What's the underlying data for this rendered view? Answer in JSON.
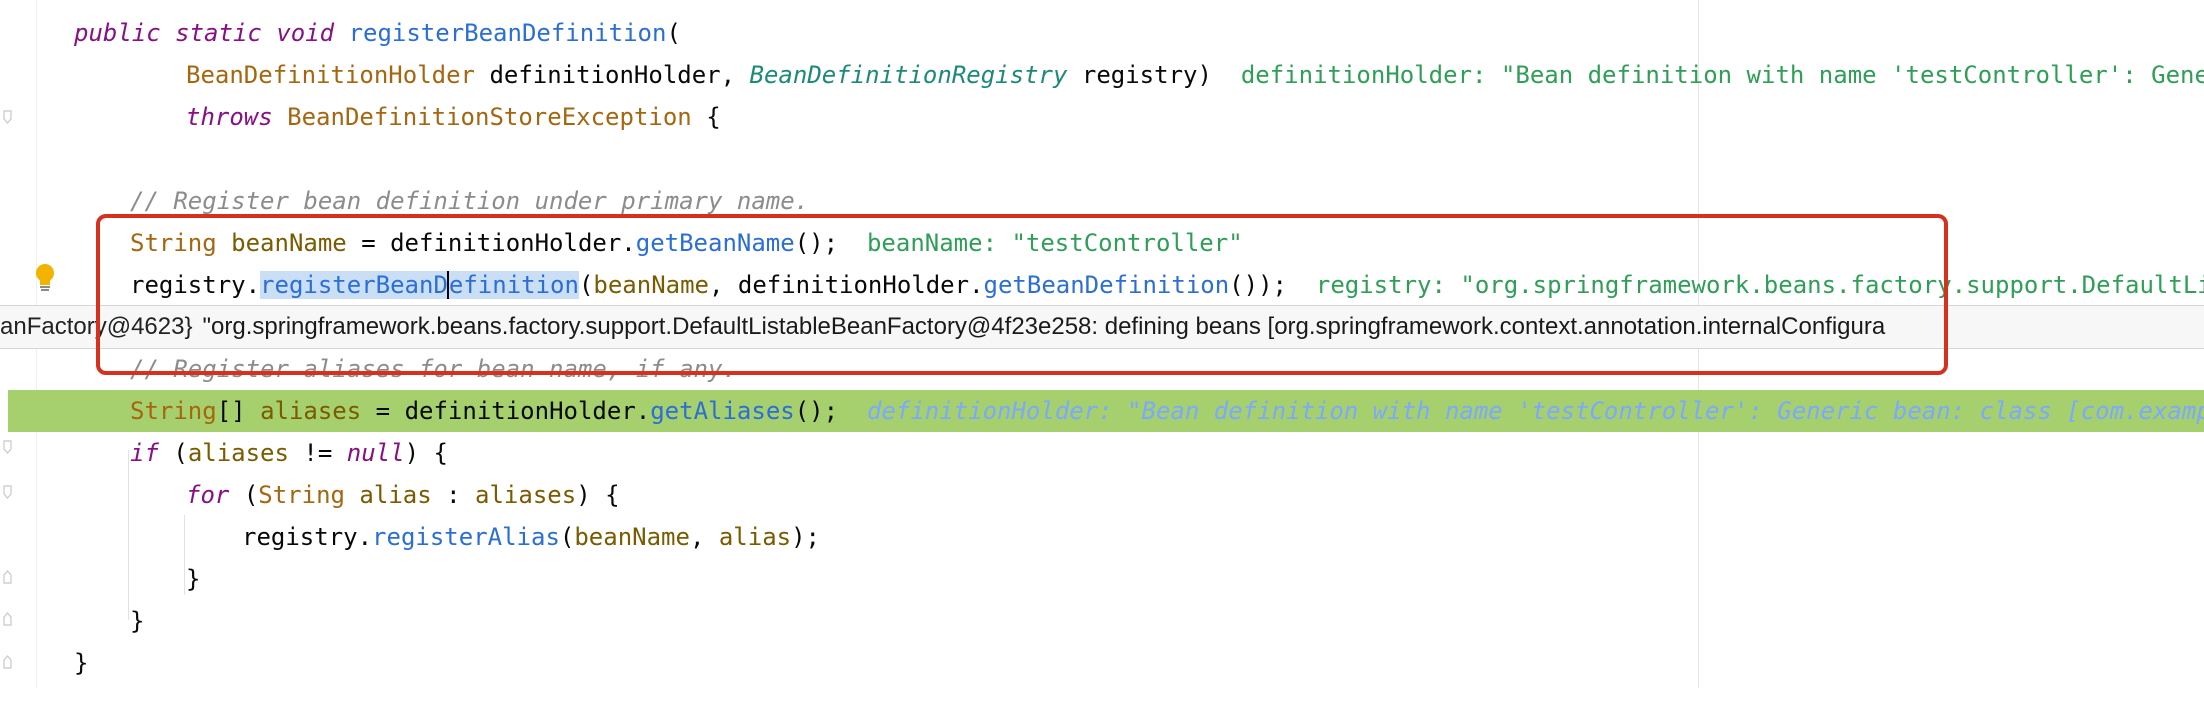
{
  "editor": {
    "line_signature": {
      "kw_public": "public",
      "kw_static": "static",
      "kw_void": "void",
      "method_name": "registerBeanDefinition",
      "paren_open": "("
    },
    "line_params": {
      "type1": "BeanDefinitionHolder",
      "param1": "definitionHolder,",
      "type2": "BeanDefinitionRegistry",
      "param2": "registry)",
      "inline_value": "definitionHolder: \"Bean definition with name 'testController': Generic"
    },
    "line_throws": {
      "kw_throws": "throws",
      "exception": "BeanDefinitionStoreException",
      "brace": "{"
    },
    "line_comment1": "// Register bean definition under primary name.",
    "line_beanname": {
      "type": "String",
      "var": "beanName",
      "eq": "=",
      "obj": "definitionHolder.",
      "call": "getBeanName",
      "tail": "();",
      "inline_value": "beanName: \"testController\""
    },
    "line_register": {
      "obj": "registry.",
      "call_selected_a": "registerBeanD",
      "call_selected_b": "efinition",
      "open": "(",
      "arg1": "beanName",
      "sep": ", definitionHolder.",
      "call2": "getBeanDefinition",
      "tail": "());",
      "inline_value": "registry: \"org.springframework.beans.factory.support.DefaultListab"
    },
    "line_comment2": "// Register aliases for bean name, if any.",
    "line_aliases": {
      "type": "String",
      "brackets": "[]",
      "var": "aliases",
      "eq": "=",
      "obj": "definitionHolder.",
      "call": "getAliases",
      "tail": "();",
      "inline_value": "definitionHolder: \"Bean definition with name 'testController': Generic bean: class [com.example.d"
    },
    "line_if": {
      "kw_if": "if",
      "open": "(",
      "var": "aliases",
      "op": "!=",
      "kw_null": "null",
      "close": ") {"
    },
    "line_for": {
      "kw_for": "for",
      "open": "(",
      "type": "String",
      "var": "alias",
      "colon": ":",
      "coll": "aliases",
      "close": ") {"
    },
    "line_alias_call": {
      "obj": "registry.",
      "call": "registerAlias",
      "open": "(",
      "arg1": "beanName",
      "sep": ", ",
      "arg2": "alias",
      "close": ");"
    },
    "brace_close_inner": "}",
    "brace_close_if": "}",
    "brace_close_method": "}"
  },
  "tooltip": {
    "type_label": "anFactory@4623}",
    "value": "\"org.springframework.beans.factory.support.DefaultListableBeanFactory@4f23e258: defining beans [org.springframework.context.annotation.internalConfigura"
  },
  "colors": {
    "highlight_line": "#a6cf6d",
    "annotation_box": "#d6301f",
    "selection": "#cadef6"
  }
}
